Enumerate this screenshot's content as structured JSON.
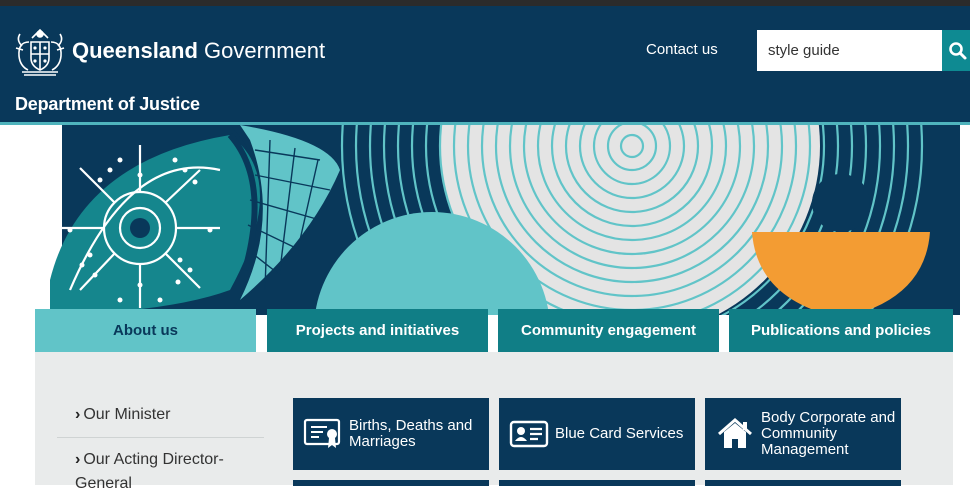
{
  "header": {
    "brand_bold": "Queensland",
    "brand_regular": "Government",
    "department": "Department of Justice",
    "contact_link": "Contact us",
    "search_value": "style guide"
  },
  "tabs": [
    {
      "label": "About us",
      "active": true
    },
    {
      "label": "Projects and initiatives",
      "active": false
    },
    {
      "label": "Community engagement",
      "active": false
    },
    {
      "label": "Publications and policies",
      "active": false
    }
  ],
  "sidenav": [
    {
      "label": "Our Minister"
    },
    {
      "label": "Our Acting Director-General"
    }
  ],
  "cards": [
    {
      "label": "Births, Deaths and Marriages",
      "icon": "certificate-icon"
    },
    {
      "label": "Blue Card Services",
      "icon": "id-card-icon"
    },
    {
      "label": "Body Corporate and Community Management",
      "icon": "home-icon"
    }
  ],
  "colors": {
    "header": "#09385a",
    "teal": "#107e86",
    "light_teal": "#61c4c8",
    "orange": "#f39c33"
  }
}
